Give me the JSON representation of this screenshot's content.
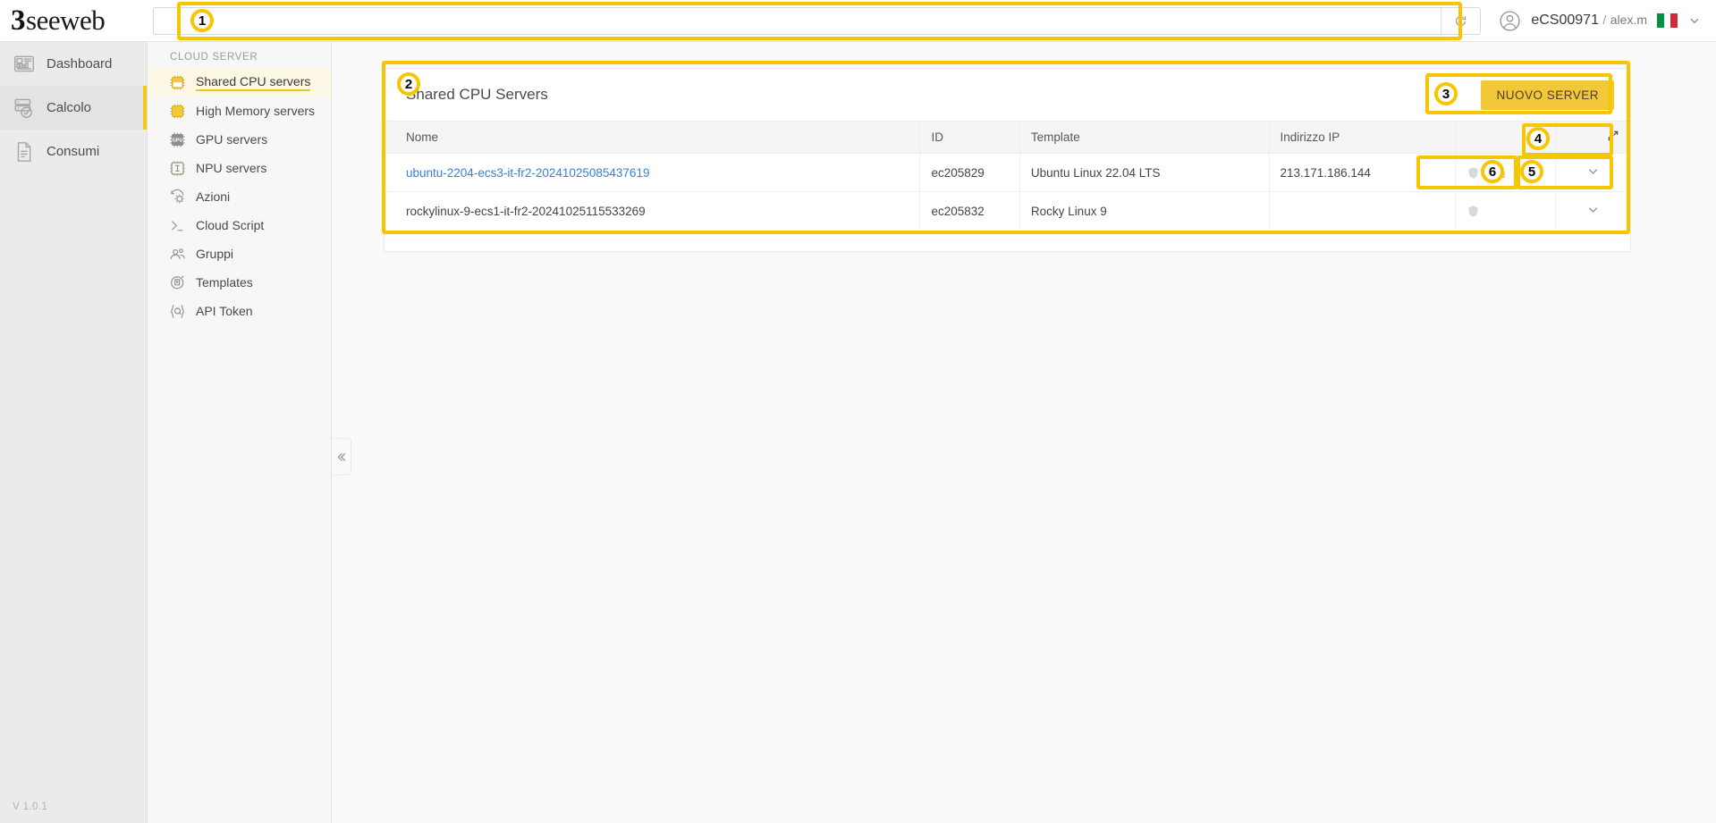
{
  "brand": {
    "logo_text": "seeweb",
    "logo_mark": "3"
  },
  "topbar": {
    "search": {
      "value": "",
      "placeholder": ""
    },
    "refresh_icon": "refresh-icon",
    "user": {
      "account": "eCS00971",
      "separator": "/",
      "username": "alex.m",
      "avatar_icon": "user-avatar-icon",
      "flag": "italian-flag",
      "caret_icon": "chevron-down-icon"
    }
  },
  "sidebar_primary": {
    "items": [
      {
        "label": "Dashboard",
        "icon": "dashboard-icon",
        "active": false
      },
      {
        "label": "Calcolo",
        "icon": "server-stack-icon",
        "active": true
      },
      {
        "label": "Consumi",
        "icon": "document-icon",
        "active": false
      }
    ],
    "version": "V 1.0.1"
  },
  "sidebar_secondary": {
    "section_title": "CLOUD SERVER",
    "items": [
      {
        "label": "Shared CPU servers",
        "icon": "cpu-chip-icon",
        "active": true
      },
      {
        "label": "High Memory servers",
        "icon": "memory-chip-icon",
        "active": false
      },
      {
        "label": "GPU servers",
        "icon": "gpu-chip-icon",
        "active": false
      },
      {
        "label": "NPU servers",
        "icon": "npu-chip-icon",
        "active": false
      },
      {
        "label": "Azioni",
        "icon": "actions-gear-icon",
        "active": false
      },
      {
        "label": "Cloud Script",
        "icon": "terminal-prompt-icon",
        "active": false
      },
      {
        "label": "Gruppi",
        "icon": "users-group-icon",
        "active": false
      },
      {
        "label": "Templates",
        "icon": "template-icon",
        "active": false
      },
      {
        "label": "API Token",
        "icon": "api-token-icon",
        "active": false
      }
    ],
    "collapse_icon": "double-chevron-left-icon"
  },
  "main": {
    "card_title": "Shared CPU Servers",
    "new_server_button": "NUOVO SERVER",
    "expand_icon": "expand-diagonal-icon",
    "table": {
      "columns": [
        "Nome",
        "ID",
        "Template",
        "Indirizzo IP",
        "",
        ""
      ],
      "rows": [
        {
          "name": "ubuntu-2204-ecs3-it-fr2-20241025085437619",
          "name_is_link": true,
          "id": "ec205829",
          "template": "Ubuntu Linux 22.04 LTS",
          "ip": "213.171.186.144",
          "shield_icon": "shield-icon",
          "lock_icon": "lock-icon",
          "has_lock": true,
          "chevron_icon": "chevron-down-icon"
        },
        {
          "name": "rockylinux-9-ecs1-it-fr2-20241025115533269",
          "name_is_link": false,
          "id": "ec205832",
          "template": "Rocky Linux 9",
          "ip": "",
          "shield_icon": "shield-icon",
          "lock_icon": "",
          "has_lock": false,
          "chevron_icon": "chevron-down-icon"
        }
      ]
    }
  },
  "annotations": {
    "markers": [
      {
        "number": "1",
        "target": "search-bar"
      },
      {
        "number": "2",
        "target": "servers-card"
      },
      {
        "number": "3",
        "target": "new-server-button"
      },
      {
        "number": "4",
        "target": "expand-table-button"
      },
      {
        "number": "5",
        "target": "row-actions-chevron"
      },
      {
        "number": "6",
        "target": "row-security-icons"
      }
    ]
  },
  "colors": {
    "accent": "#f5c518",
    "annotation": "#f7c600",
    "link": "#3b7fd4",
    "button_bg": "#f2c838"
  }
}
